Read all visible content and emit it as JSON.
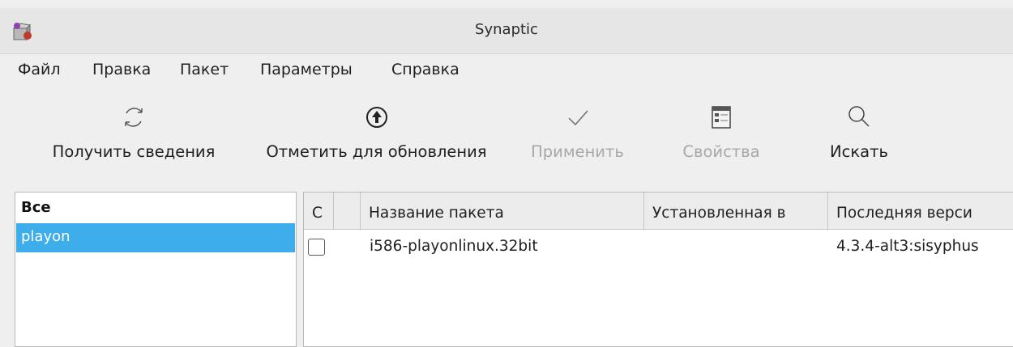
{
  "window": {
    "title": "Synaptic"
  },
  "menu": [
    "Файл",
    "Правка",
    "Пакет",
    "Параметры",
    "Справка"
  ],
  "toolbar": {
    "reload_label": "Получить сведения",
    "mark_upgrades_label": "Отметить для обновления",
    "apply_label": "Применить",
    "properties_label": "Свойства",
    "search_label": "Искать"
  },
  "filters": {
    "header": "Все",
    "items": [
      "playon"
    ]
  },
  "package_table": {
    "columns": [
      "С",
      "",
      "Название пакета",
      "Установленная в",
      "Последняя верси"
    ],
    "rows": [
      {
        "checked": false,
        "name": "i586-playonlinux.32bit",
        "installed": "",
        "latest": "4.3.4-alt3:sisyphus"
      }
    ]
  }
}
